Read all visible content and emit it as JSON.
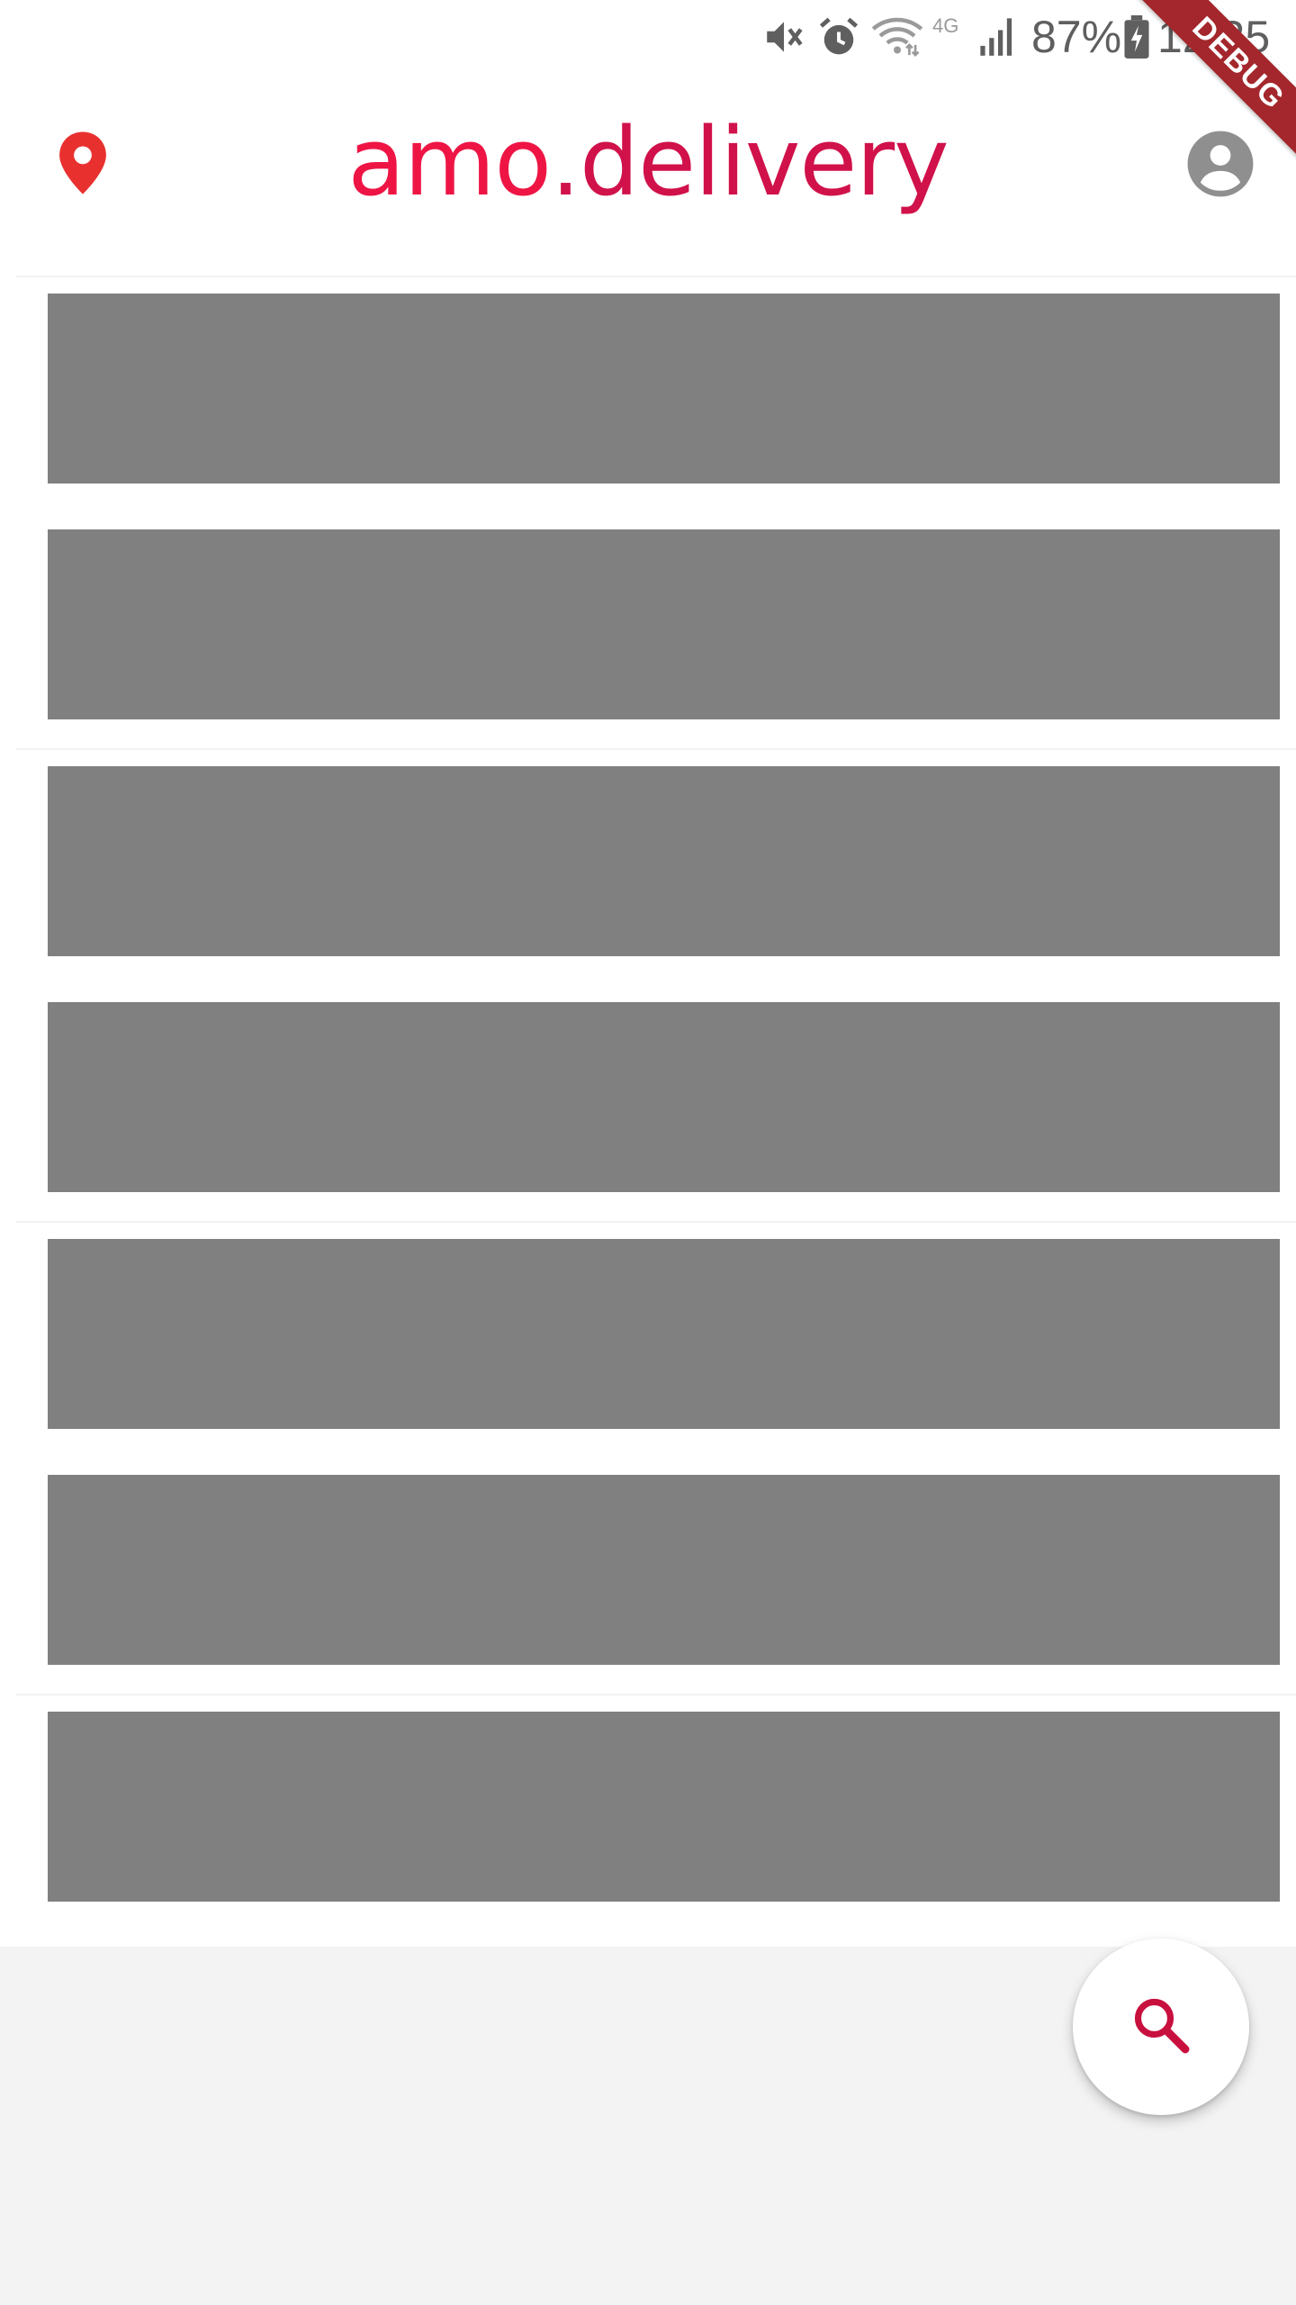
{
  "status_bar": {
    "network": "4G",
    "battery": "87%",
    "time": "12:35",
    "icons": [
      "mute-icon",
      "alarm-icon",
      "wifi-icon",
      "signal-icon",
      "battery-charging-icon"
    ]
  },
  "app_bar": {
    "logo_text_part1": "amo",
    "logo_text_part2": ".delivery",
    "location_icon": "location-pin-icon",
    "profile_icon": "account-circle-icon"
  },
  "debug_banner": {
    "label": "DEBUG"
  },
  "content": {
    "placeholder_count": 7,
    "placeholder_color": "#808080"
  },
  "fab": {
    "icon": "search-icon"
  },
  "colors": {
    "brand_primary": "#ee1545",
    "brand_secondary": "#d0114a",
    "location_pin": "#e8312f",
    "profile_icon": "#8f8f8f",
    "page_background": "#f3f3f3",
    "debug_banner": "#a3272c"
  }
}
